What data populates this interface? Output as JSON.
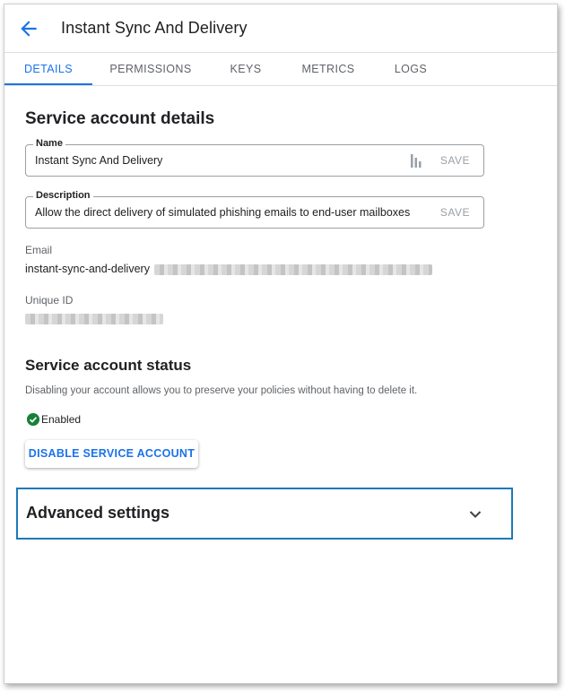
{
  "header": {
    "title": "Instant Sync And Delivery"
  },
  "tabs": [
    {
      "label": "DETAILS",
      "active": true
    },
    {
      "label": "PERMISSIONS",
      "active": false
    },
    {
      "label": "KEYS",
      "active": false
    },
    {
      "label": "METRICS",
      "active": false
    },
    {
      "label": "LOGS",
      "active": false
    }
  ],
  "details": {
    "title": "Service account details",
    "name_field": {
      "label": "Name",
      "value": "Instant Sync And Delivery",
      "action": "SAVE"
    },
    "description_field": {
      "label": "Description",
      "value": "Allow the direct delivery of simulated phishing emails to end-user mailboxes",
      "action": "SAVE"
    },
    "email": {
      "label": "Email",
      "value": "instant-sync-and-delivery"
    },
    "unique_id": {
      "label": "Unique ID"
    }
  },
  "status_section": {
    "title": "Service account status",
    "description": "Disabling your account allows you to preserve your policies without having to delete it.",
    "status": "Enabled",
    "button": "DISABLE SERVICE ACCOUNT"
  },
  "advanced": {
    "label": "Advanced settings"
  },
  "colors": {
    "accent": "#1a73e8",
    "enabled": "#188038",
    "highlight_border": "#1c7ab8"
  },
  "icons": [
    "back-arrow-icon",
    "bars-icon",
    "check-circle-icon",
    "chevron-down-icon"
  ]
}
